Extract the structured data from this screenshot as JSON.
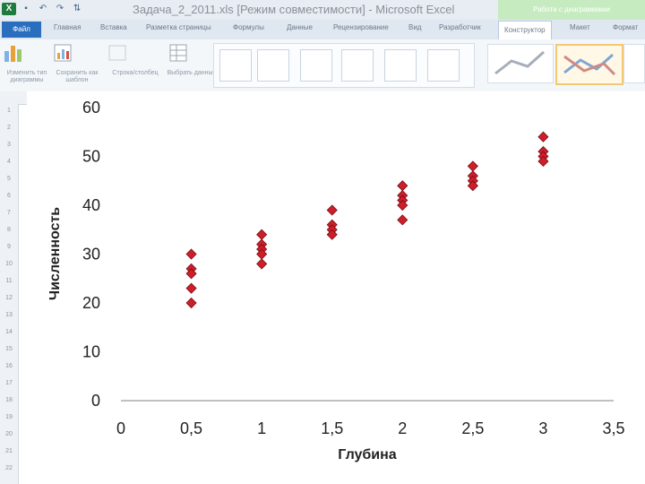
{
  "window": {
    "title": "Задача_2_2011.xls [Режим совместимости] - Microsoft Excel",
    "context_tab_title": "Работа с диаграммами"
  },
  "tabs": {
    "file": "Файл",
    "items": [
      {
        "label": "Главная"
      },
      {
        "label": "Вставка"
      },
      {
        "label": "Разметка страницы"
      },
      {
        "label": "Формулы"
      },
      {
        "label": "Данные"
      },
      {
        "label": "Рецензирование"
      },
      {
        "label": "Вид"
      },
      {
        "label": "Разработчик"
      }
    ],
    "active": "Конструктор",
    "layout": "Макет",
    "format": "Формат"
  },
  "ribbon": {
    "change_type": "Изменить тип диаграммы",
    "save_template": "Сохранить как шаблон",
    "switch_row_col": "Строка/столбец",
    "select_data": "Выбрать данные"
  },
  "row_numbers": [
    "1",
    "2",
    "3",
    "4",
    "5",
    "6",
    "7",
    "8",
    "9",
    "10",
    "11",
    "12",
    "13",
    "14",
    "15",
    "16",
    "17",
    "18",
    "19",
    "20",
    "21",
    "22"
  ],
  "chart_data": {
    "type": "scatter",
    "xlabel": "Глубина",
    "ylabel": "Численность",
    "xlim": [
      0,
      3.5
    ],
    "ylim": [
      0,
      60
    ],
    "x_ticks": [
      "0",
      "0,5",
      "1",
      "1,5",
      "2",
      "2,5",
      "3",
      "3,5"
    ],
    "y_ticks": [
      "0",
      "10",
      "20",
      "30",
      "40",
      "50",
      "60"
    ],
    "grid": false,
    "marker_color": "#cc1f2a",
    "points": [
      {
        "x": 0.5,
        "y": 30
      },
      {
        "x": 0.5,
        "y": 27
      },
      {
        "x": 0.5,
        "y": 26
      },
      {
        "x": 0.5,
        "y": 23
      },
      {
        "x": 0.5,
        "y": 20
      },
      {
        "x": 1,
        "y": 34
      },
      {
        "x": 1,
        "y": 32
      },
      {
        "x": 1,
        "y": 31
      },
      {
        "x": 1,
        "y": 30
      },
      {
        "x": 1,
        "y": 28
      },
      {
        "x": 1.5,
        "y": 39
      },
      {
        "x": 1.5,
        "y": 36
      },
      {
        "x": 1.5,
        "y": 35
      },
      {
        "x": 1.5,
        "y": 34
      },
      {
        "x": 2,
        "y": 44
      },
      {
        "x": 2,
        "y": 42
      },
      {
        "x": 2,
        "y": 41
      },
      {
        "x": 2,
        "y": 40
      },
      {
        "x": 2,
        "y": 37
      },
      {
        "x": 2.5,
        "y": 48
      },
      {
        "x": 2.5,
        "y": 46
      },
      {
        "x": 2.5,
        "y": 45
      },
      {
        "x": 2.5,
        "y": 44
      },
      {
        "x": 3,
        "y": 54
      },
      {
        "x": 3,
        "y": 51
      },
      {
        "x": 3,
        "y": 50
      },
      {
        "x": 3,
        "y": 49
      }
    ]
  }
}
